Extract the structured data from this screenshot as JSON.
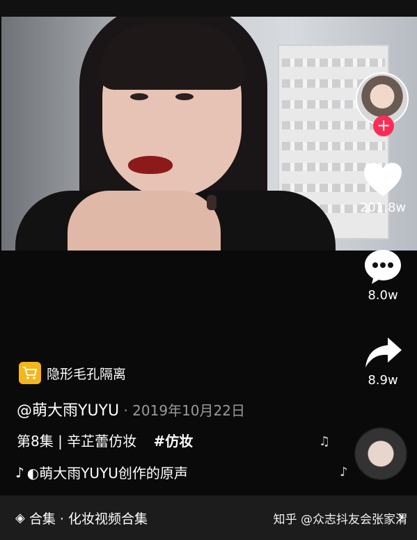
{
  "video": {},
  "rail": {
    "like_count": "201.8w",
    "comment_count": "8.0w",
    "share_count": "8.9w"
  },
  "shop": {
    "label": "隐形毛孔隔离"
  },
  "author": {
    "handle": "@萌大雨YUYU",
    "date": " · 2019年10月22日"
  },
  "caption": {
    "text": "第8集 | 辛芷蕾仿妆",
    "tag": "#仿妆"
  },
  "music": {
    "text": "◐萌大雨YUYU创作的原声"
  },
  "collection": {
    "label": "合集 · 化妆视频合集"
  },
  "watermark": {
    "text": "知乎 @众志抖友会张家渭"
  },
  "colors": {
    "follow": "#fe2c55",
    "shop_badge": "#f5b51b",
    "background": "#000000"
  },
  "icons": [
    "heart-icon",
    "comment-icon",
    "share-icon",
    "shopping-bag-icon",
    "music-note-icon",
    "layers-icon",
    "chevron-right-icon",
    "tiktok-icon"
  ]
}
